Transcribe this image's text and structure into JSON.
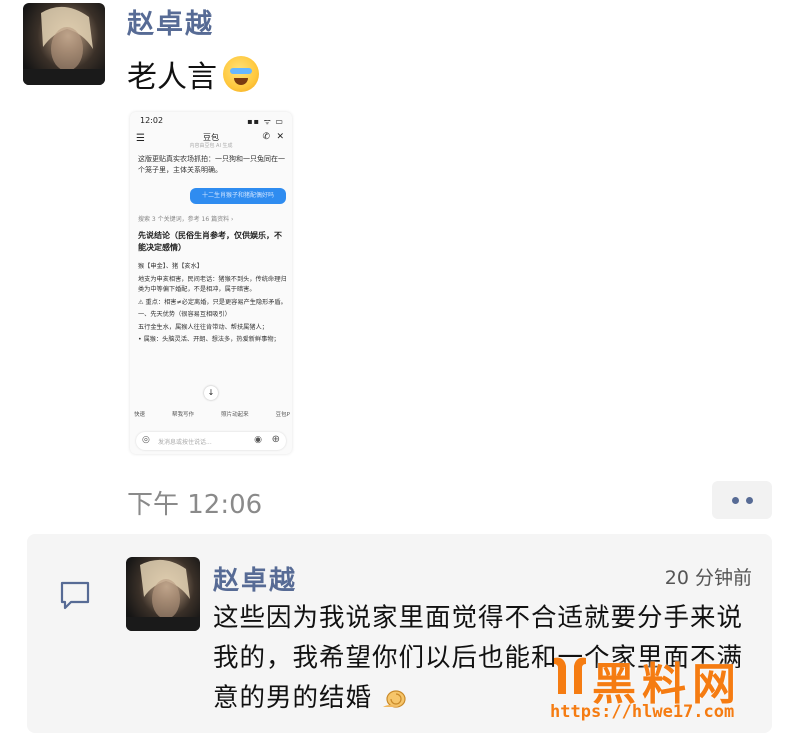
{
  "top_message": {
    "sender": "赵卓越",
    "text": "老人言",
    "emoji": "laughing-crying-emoji"
  },
  "phone_screenshot": {
    "status_time": "12:02",
    "status_icons": "▪▪ ᯤ ▭",
    "title": "豆包",
    "subtitle": "内容由豆包 AI 生成",
    "intro_text": "这版更贴真实农场抓拍：一只狗和一只兔同在一个笼子里，主体关系明确。",
    "user_bubble": "十二生肖猴子和猪配偶好吗",
    "search_note": "搜索 3 个关键词，参考 16 篇资料 ›",
    "heading": "先说结论（民俗生肖参考，仅供娱乐，不能决定感情）",
    "body": [
      "猴【申金】、猪【亥水】",
      "地支为申亥相害，民间老话：猪猴不到头，传统命理归类为中等偏下婚配，不是相冲，属于暗害。",
      "⚠ 重点：相害≠必定离婚，只是更容易产生隐形矛盾。",
      "一、先天优势（很容易互相吸引）",
      "五行金生水，属猴人往往肯带动、帮扶属猪人；",
      "• 属猴：头脑灵活、开朗、想法多，热爱新鲜事物；"
    ],
    "tools": [
      "快速",
      "帮我写作",
      "照片动起来",
      "豆包P"
    ],
    "input_placeholder": "发消息或按住说话..."
  },
  "timestamp": "下午 12:06",
  "comment": {
    "name": "赵卓越",
    "time": "20 分钟前",
    "text": "这些因为我说家里面觉得不合适就要分手来说我的，我希望你们以后也能和一个家里面不满意的男的结婚",
    "emoji": "snail-emoji"
  },
  "watermark": {
    "text": "黑料网",
    "url": "https://hlwe17.com"
  },
  "colors": {
    "name_blue": "#576b95",
    "watermark_orange": "#f57c12",
    "bubble_blue": "#2f8cf0"
  }
}
